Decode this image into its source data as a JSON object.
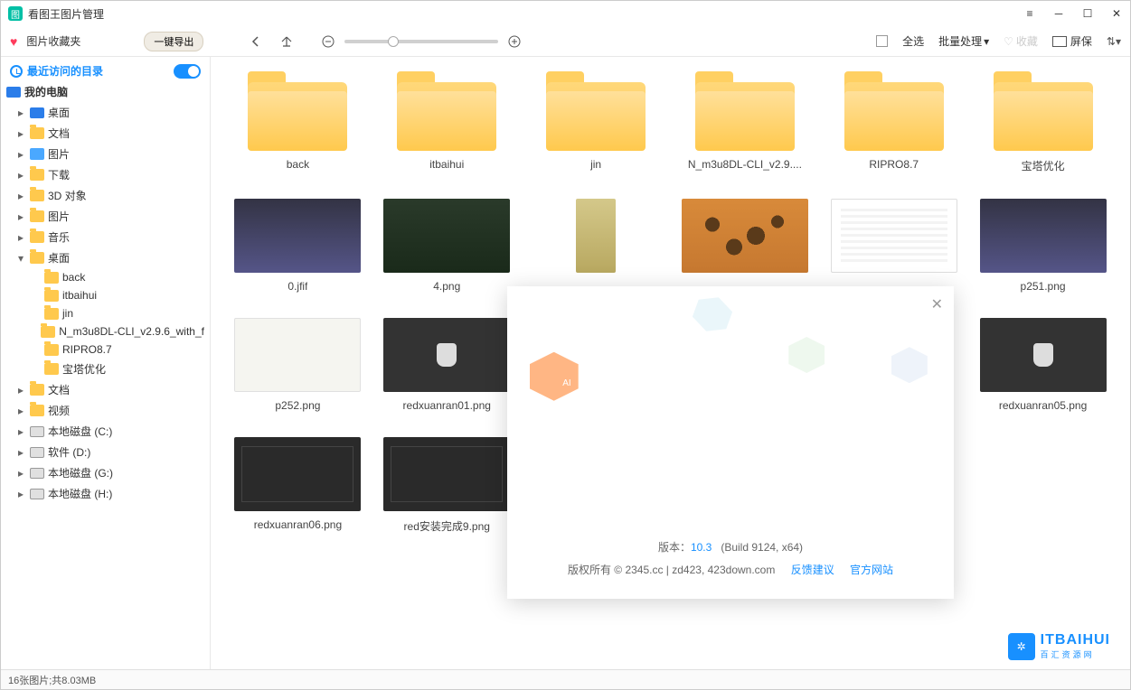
{
  "app": {
    "title": "看图王图片管理"
  },
  "toolbar": {
    "favorites_label": "图片收藏夹",
    "export_label": "一键导出",
    "select_all": "全选",
    "batch_process": "批量处理",
    "favorite": "收藏",
    "screensaver": "屏保"
  },
  "sidebar": {
    "recent_label": "最近访问的目录",
    "my_computer": "我的电脑",
    "items": [
      {
        "label": "桌面",
        "icon": "monitor",
        "depth": 1
      },
      {
        "label": "文档",
        "icon": "doc",
        "depth": 1
      },
      {
        "label": "图片",
        "icon": "pic",
        "depth": 1
      },
      {
        "label": "下载",
        "icon": "folder",
        "depth": 1
      },
      {
        "label": "3D 对象",
        "icon": "folder",
        "depth": 1
      },
      {
        "label": "图片",
        "icon": "folder",
        "depth": 1
      },
      {
        "label": "音乐",
        "icon": "folder",
        "depth": 1
      },
      {
        "label": "桌面",
        "icon": "folder",
        "depth": 1,
        "expanded": true
      },
      {
        "label": "back",
        "icon": "folder",
        "depth": 2
      },
      {
        "label": "itbaihui",
        "icon": "folder",
        "depth": 2
      },
      {
        "label": "jin",
        "icon": "folder",
        "depth": 2
      },
      {
        "label": "N_m3u8DL-CLI_v2.9.6_with_f",
        "icon": "folder",
        "depth": 2
      },
      {
        "label": "RIPRO8.7",
        "icon": "folder",
        "depth": 2
      },
      {
        "label": "宝塔优化",
        "icon": "folder",
        "depth": 2
      },
      {
        "label": "文档",
        "icon": "folder",
        "depth": 1
      },
      {
        "label": "视频",
        "icon": "folder",
        "depth": 1
      },
      {
        "label": "本地磁盘 (C:)",
        "icon": "disk",
        "depth": 1
      },
      {
        "label": "软件 (D:)",
        "icon": "disk",
        "depth": 1
      },
      {
        "label": "本地磁盘 (G:)",
        "icon": "disk",
        "depth": 1
      },
      {
        "label": "本地磁盘 (H:)",
        "icon": "disk",
        "depth": 1
      }
    ]
  },
  "grid": {
    "folders": [
      "back",
      "itbaihui",
      "jin",
      "N_m3u8DL-CLI_v2.9....",
      "RIPRO8.7",
      "宝塔优化"
    ],
    "files": [
      {
        "name": "0.jfif",
        "style": "girl"
      },
      {
        "name": "4.png",
        "style": "nature"
      },
      {
        "name": "",
        "style": "narrow"
      },
      {
        "name": "",
        "style": "orange"
      },
      {
        "name": "",
        "style": "white-list"
      },
      {
        "name": "p251.png",
        "style": "girl"
      },
      {
        "name": "p252.png",
        "style": "light"
      },
      {
        "name": "redxuanran01.png",
        "style": "cup"
      },
      {
        "name": "",
        "style": ""
      },
      {
        "name": "",
        "style": ""
      },
      {
        "name": "",
        "style": ""
      },
      {
        "name": "redxuanran05.png",
        "style": "cup"
      },
      {
        "name": "redxuanran06.png",
        "style": "dark-ui"
      },
      {
        "name": "red安装完成9.png",
        "style": "dark-ui"
      }
    ]
  },
  "dialog": {
    "version_label": "版本：",
    "version": "10.3",
    "build": "(Build 9124, x64)",
    "copyright": "版权所有 © 2345.cc | zd423, 423down.com",
    "feedback": "反馈建议",
    "official": "官方网站"
  },
  "status": {
    "text": "16张图片;共8.03MB"
  },
  "watermark": {
    "brand": "ITBAIHUI",
    "sub": "百汇资源网"
  }
}
